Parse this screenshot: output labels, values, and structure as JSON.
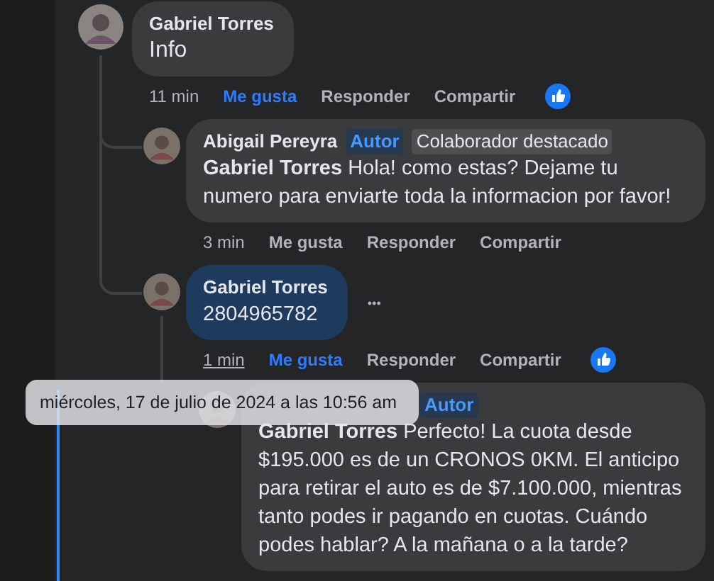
{
  "comments": [
    {
      "author": "Gabriel Torres",
      "text": "Info",
      "highlighted": false,
      "time": "11 min",
      "time_underlined": false,
      "actions": [
        {
          "label": "Me gusta",
          "selected": true
        },
        {
          "label": "Responder",
          "selected": false
        },
        {
          "label": "Compartir",
          "selected": false
        }
      ],
      "reacted": true,
      "children": [
        {
          "author": "Abigail Pereyra",
          "badges": [
            {
              "label": "Autor",
              "kind": "author"
            },
            {
              "label": "Colaborador destacado",
              "kind": "featured"
            }
          ],
          "text": "**Gabriel Torres** Hola! como estas? Dejame tu numero para enviarte toda la informacion por favor!",
          "highlighted": false,
          "time": "3 min",
          "time_underlined": false,
          "actions": [
            {
              "label": "Me gusta",
              "selected": false
            },
            {
              "label": "Responder",
              "selected": false
            },
            {
              "label": "Compartir",
              "selected": false
            }
          ]
        },
        {
          "author": "Gabriel Torres",
          "text": "2804965782",
          "highlighted": true,
          "more": "•••",
          "time": "1 min",
          "time_underlined": true,
          "actions": [
            {
              "label": "Me gusta",
              "selected": true
            },
            {
              "label": "Responder",
              "selected": false
            },
            {
              "label": "Compartir",
              "selected": false
            }
          ],
          "reacted": true,
          "children": [
            {
              "badges": [
                {
                  "label": "Autor",
                  "kind": "author"
                }
              ],
              "text": "**Gabriel Torres** Perfecto! La cuota desde $195.000 es de un CRONOS 0KM. El anticipo para retirar el auto es de $7.100.000, mientras tanto podes ir pagando en cuotas. Cuándo podes hablar? A la mañana o a la tarde?",
              "highlighted": false
            }
          ]
        }
      ]
    }
  ],
  "tooltip": "miércoles, 17 de julio de 2024 a las 10:56 am"
}
